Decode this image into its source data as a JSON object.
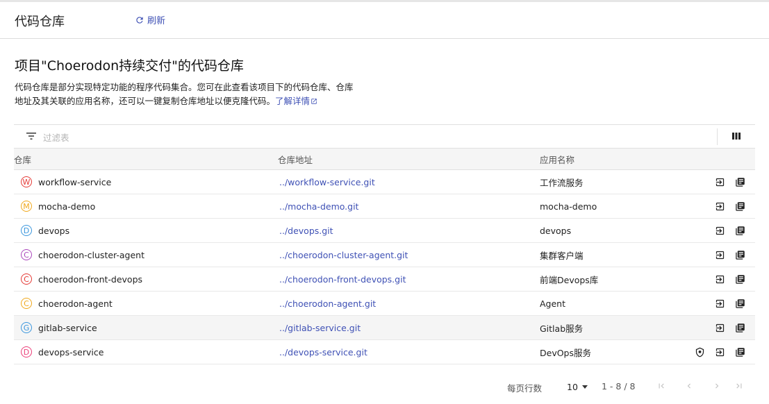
{
  "header": {
    "title": "代码仓库",
    "refresh_label": "刷新"
  },
  "main": {
    "title": "项目\"Choerodon持续交付\"的代码仓库",
    "desc_line1": "代码仓库是部分实现特定功能的程序代码集合。您可在此查看该项目下的代码仓库、仓库",
    "desc_line2": "地址及其关联的应用名称，还可以一键复制仓库地址以便克隆代码。",
    "learn_more": "了解详情"
  },
  "filter": {
    "placeholder": "过滤表"
  },
  "table": {
    "columns": [
      "仓库",
      "仓库地址",
      "应用名称"
    ],
    "rows": [
      {
        "letter": "W",
        "color": "#e53935",
        "name": "workflow-service",
        "url": "../workflow-service.git",
        "app": "工作流服务",
        "shield": false,
        "highlight": false
      },
      {
        "letter": "M",
        "color": "#f0a81c",
        "name": "mocha-demo",
        "url": "../mocha-demo.git",
        "app": "mocha-demo",
        "shield": false,
        "highlight": false
      },
      {
        "letter": "D",
        "color": "#3a96dd",
        "name": "devops",
        "url": "../devops.git",
        "app": "devops",
        "shield": false,
        "highlight": false
      },
      {
        "letter": "C",
        "color": "#ab47bc",
        "name": "choerodon-cluster-agent",
        "url": "../choerodon-cluster-agent.git",
        "app": "集群客户端",
        "shield": false,
        "highlight": false
      },
      {
        "letter": "C",
        "color": "#e53935",
        "name": "choerodon-front-devops",
        "url": "../choerodon-front-devops.git",
        "app": "前端Devops库",
        "shield": false,
        "highlight": false
      },
      {
        "letter": "C",
        "color": "#f0a81c",
        "name": "choerodon-agent",
        "url": "../choerodon-agent.git",
        "app": "Agent",
        "shield": false,
        "highlight": false
      },
      {
        "letter": "G",
        "color": "#3a96dd",
        "name": "gitlab-service",
        "url": "../gitlab-service.git",
        "app": "Gitlab服务",
        "shield": false,
        "highlight": true
      },
      {
        "letter": "D",
        "color": "#ec407a",
        "name": "devops-service",
        "url": "../devops-service.git",
        "app": "DevOps服务",
        "shield": true,
        "highlight": false
      }
    ]
  },
  "pagination": {
    "rows_label": "每页行数",
    "page_size": "10",
    "range": "1 - 8 / 8"
  },
  "icons": [
    "refresh-icon",
    "external-link-icon",
    "filter-icon",
    "columns-icon",
    "shield-icon",
    "enter-icon",
    "copy-icon",
    "chevron-down-icon",
    "first-page-icon",
    "prev-page-icon",
    "next-page-icon",
    "last-page-icon"
  ]
}
